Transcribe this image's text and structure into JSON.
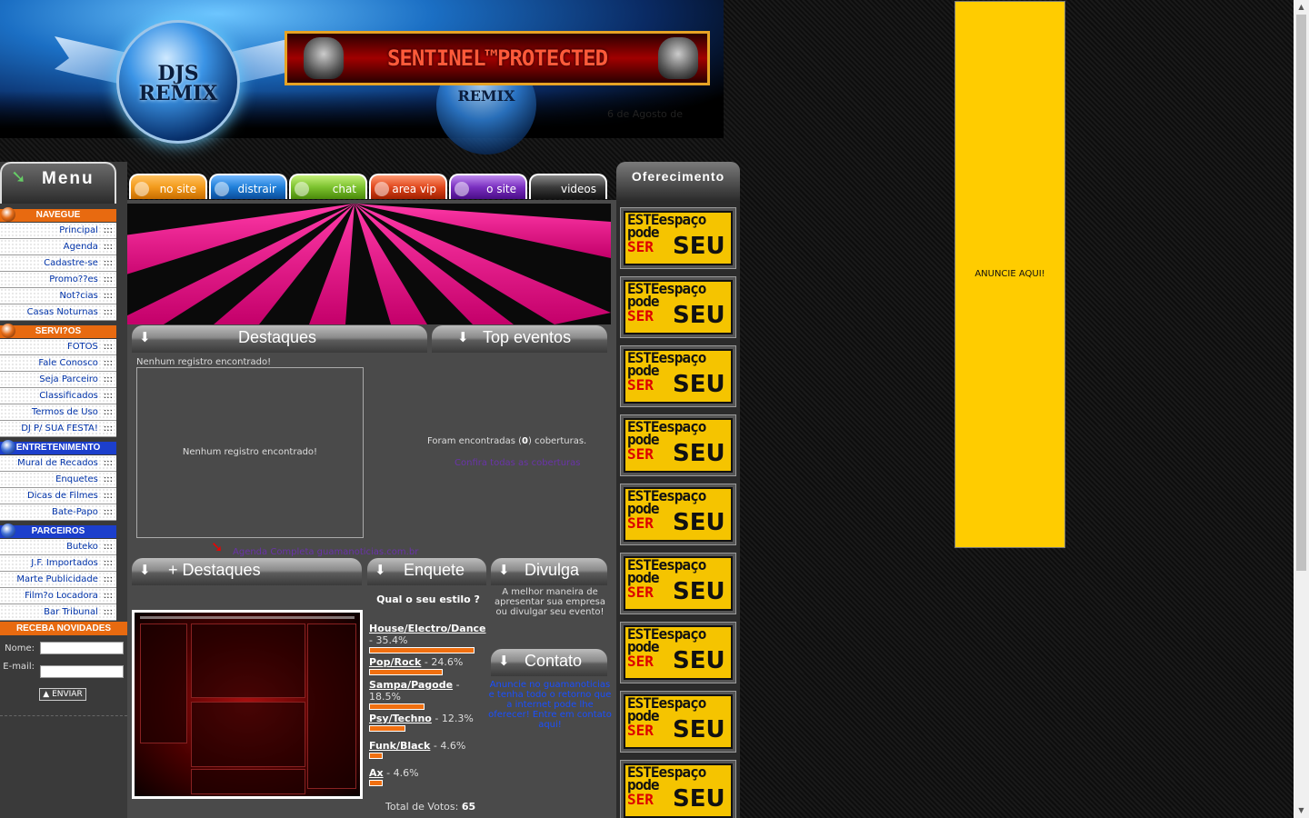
{
  "header": {
    "logo_text": "DJS REMIX",
    "orb2_text": "REMIX",
    "sentinel_text": "SENTINEL™PROTECTED",
    "date": "6 de Agosto de"
  },
  "menu": {
    "title": "Menu",
    "sections": [
      {
        "title": "NAVEGUE",
        "items": [
          "Principal",
          "Agenda",
          "Cadastre-se",
          "Promo??es",
          "Not?cias",
          "Casas Noturnas"
        ]
      },
      {
        "title": "SERVI?OS",
        "items": [
          "FOTOS",
          "Fale Conosco",
          "Seja Parceiro",
          "Classificados",
          "Termos de Uso",
          "DJ P/ SUA FESTA!"
        ]
      },
      {
        "title": "ENTRETENIMENTO",
        "items": [
          "Mural de Recados",
          "Enquetes",
          "Dicas de Filmes",
          "Bate-Papo"
        ]
      },
      {
        "title": "PARCEIROS",
        "items": [
          "Buteko",
          "J.F. Importados",
          "Marte Publicidade",
          "Film?o Locadora",
          "Bar Tribunal"
        ]
      }
    ],
    "dots": ":::",
    "newsletter": {
      "title": "RECEBA NOVIDADES",
      "name_label": "Nome:",
      "email_label": "E-mail:",
      "submit_label": "ENVIAR"
    }
  },
  "tabs": [
    {
      "label": "no site",
      "color": "#f39a1b"
    },
    {
      "label": "distrair",
      "color": "#1f7fd8"
    },
    {
      "label": "chat",
      "color": "#7cc22e"
    },
    {
      "label": "area vip",
      "color": "#e0461c"
    },
    {
      "label": "o site",
      "color": "#7a2fc0"
    },
    {
      "label": "videos",
      "color": "#3a3a3a"
    }
  ],
  "sections": {
    "destaques": "Destaques",
    "top_eventos": "Top eventos",
    "mais_destaques": "+ Destaques",
    "enquete": "Enquete",
    "divulga": "Divulga",
    "contato": "Contato"
  },
  "destaques": {
    "empty_top": "Nenhum registro encontrado!",
    "empty_inner": "Nenhum registro encontrado!"
  },
  "top_eventos": {
    "coberturas_prefix": "Foram encontradas (",
    "coberturas_count": "0",
    "coberturas_suffix": ") coberturas.",
    "link": "Confira todas as coberturas"
  },
  "agenda_link": "Agenda Completa guamanoticias.com.br",
  "enquete": {
    "question": "Qual o seu estilo ?",
    "options": [
      {
        "label": "House/Electro/Dance",
        "pct": "35.4%",
        "value": 35.4
      },
      {
        "label": "Pop/Rock",
        "pct": "24.6%",
        "value": 24.6
      },
      {
        "label": "Sampa/Pagode",
        "pct": "18.5%",
        "value": 18.5
      },
      {
        "label": "Psy/Techno",
        "pct": "12.3%",
        "value": 12.3
      },
      {
        "label": "Funk/Black",
        "pct": "4.6%",
        "value": 4.6
      },
      {
        "label": "Ax",
        "pct": "4.6%",
        "value": 4.6
      }
    ],
    "total_label": "Total de Votos:",
    "total_value": "65"
  },
  "divulga_text": "A melhor maneira de apresentar sua empresa ou divulgar seu evento!",
  "contato_text": "Anuncie no guamanoticias e tenha todo o retorno que a internet pode lhe oferecer! Entre em contato aqui!",
  "oferecimento": {
    "title": "Oferecimento",
    "ad": {
      "l1": "ESTEespaço",
      "l2": "pode",
      "l3": "SER",
      "l4": "SEU"
    },
    "count": 9
  },
  "side_banner": "ANUNCIE AQUI!"
}
